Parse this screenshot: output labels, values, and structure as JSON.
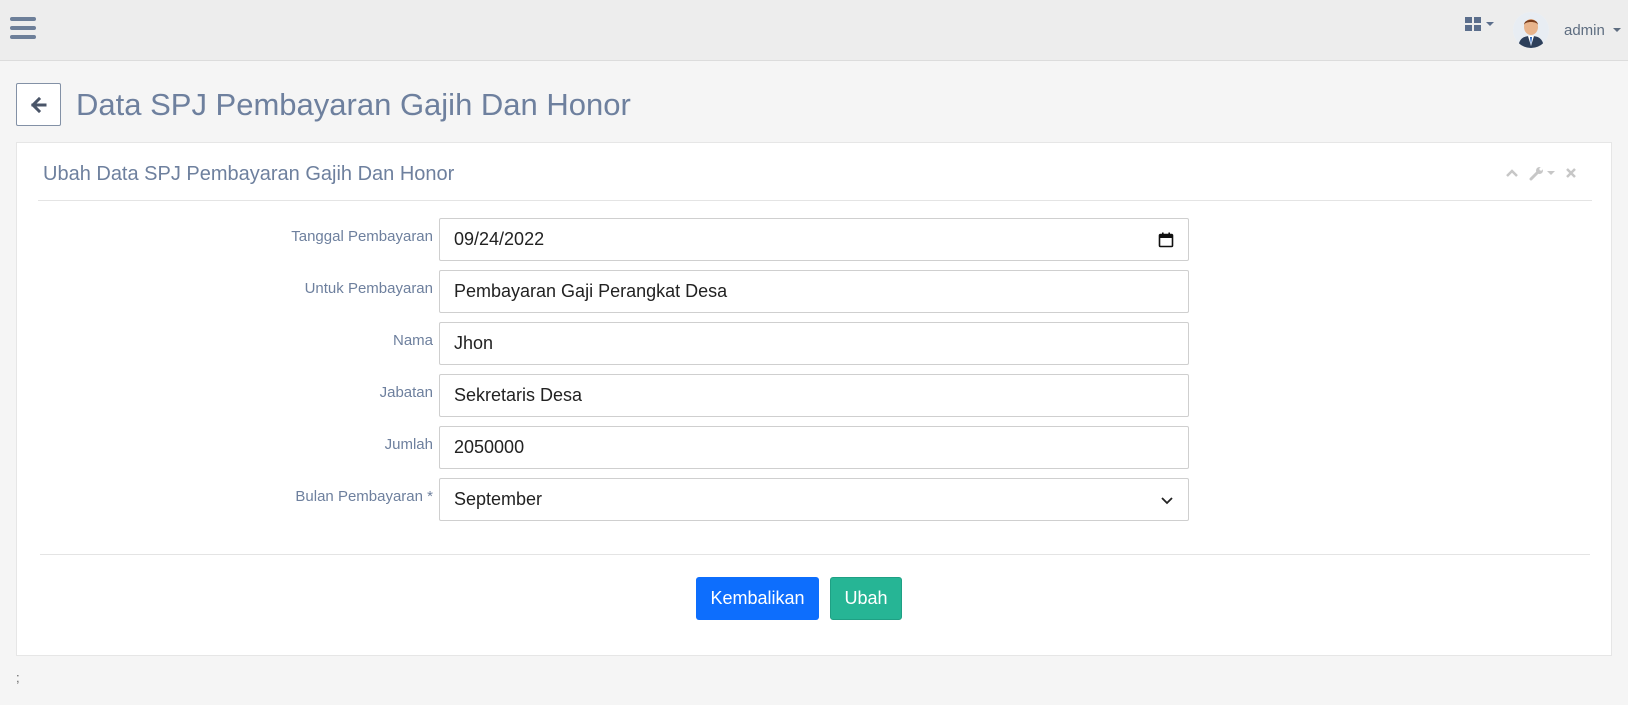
{
  "navbar": {
    "menu_icon": "hamburger-icon",
    "apps_icon": "grid-icon",
    "user": {
      "name": "admin",
      "avatar_icon": "user-avatar"
    }
  },
  "header": {
    "back_icon": "arrow-left-icon",
    "title": "Data SPJ Pembayaran Gajih Dan Honor"
  },
  "panel": {
    "title": "Ubah Data SPJ Pembayaran Gajih Dan Honor",
    "tools": [
      "chevron-up-icon",
      "wrench-icon",
      "close-icon"
    ]
  },
  "form": {
    "tanggal": {
      "label": "Tanggal Pembayaran",
      "value": "09/24/2022"
    },
    "untuk": {
      "label": "Untuk Pembayaran",
      "value": "Pembayaran Gaji Perangkat Desa"
    },
    "nama": {
      "label": "Nama",
      "value": "Jhon"
    },
    "jabatan": {
      "label": "Jabatan",
      "value": "Sekretaris Desa"
    },
    "jumlah": {
      "label": "Jumlah",
      "value": "2050000"
    },
    "bulan": {
      "label": "Bulan Pembayaran *",
      "value": "September"
    }
  },
  "actions": {
    "reset_label": "Kembalikan",
    "submit_label": "Ubah"
  },
  "footer": {
    "text": ";"
  },
  "colors": {
    "primary": "#0d6efd",
    "success": "#26b595",
    "title": "#6e809e"
  }
}
